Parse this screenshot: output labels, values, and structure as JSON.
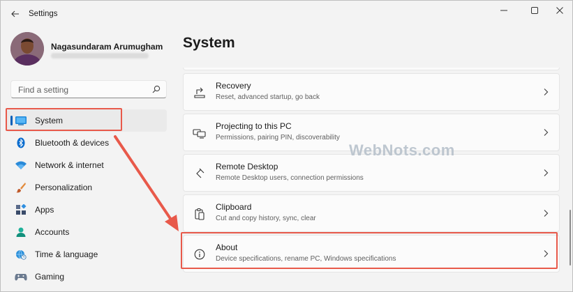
{
  "window": {
    "title": "Settings",
    "back_icon": "arrow-left-icon",
    "controls": [
      "minimize-icon",
      "maximize-icon",
      "close-icon"
    ]
  },
  "profile": {
    "name": "Nagasundaram Arumugham"
  },
  "search": {
    "placeholder": "Find a setting",
    "icon": "search-icon"
  },
  "nav": {
    "items": [
      {
        "label": "System",
        "icon": "monitor-icon",
        "active": true
      },
      {
        "label": "Bluetooth & devices",
        "icon": "bluetooth-icon"
      },
      {
        "label": "Network & internet",
        "icon": "wifi-icon"
      },
      {
        "label": "Personalization",
        "icon": "paintbrush-icon"
      },
      {
        "label": "Apps",
        "icon": "apps-icon"
      },
      {
        "label": "Accounts",
        "icon": "person-icon"
      },
      {
        "label": "Time & language",
        "icon": "globe-clock-icon"
      },
      {
        "label": "Gaming",
        "icon": "gamepad-icon"
      }
    ]
  },
  "main": {
    "title": "System",
    "cards": [
      {
        "title": "Recovery",
        "subtitle": "Reset, advanced startup, go back",
        "icon": "recovery-icon"
      },
      {
        "title": "Projecting to this PC",
        "subtitle": "Permissions, pairing PIN, discoverability",
        "icon": "projecting-icon"
      },
      {
        "title": "Remote Desktop",
        "subtitle": "Remote Desktop users, connection permissions",
        "icon": "remote-desktop-icon"
      },
      {
        "title": "Clipboard",
        "subtitle": "Cut and copy history, sync, clear",
        "icon": "clipboard-icon"
      },
      {
        "title": "About",
        "subtitle": "Device specifications, rename PC, Windows specifications",
        "icon": "info-icon"
      }
    ]
  },
  "watermark": "WebNots.com",
  "colors": {
    "accent": "#005fb8",
    "highlight": "#e8594a",
    "background": "#f3f3f3",
    "card": "#fbfbfb"
  }
}
